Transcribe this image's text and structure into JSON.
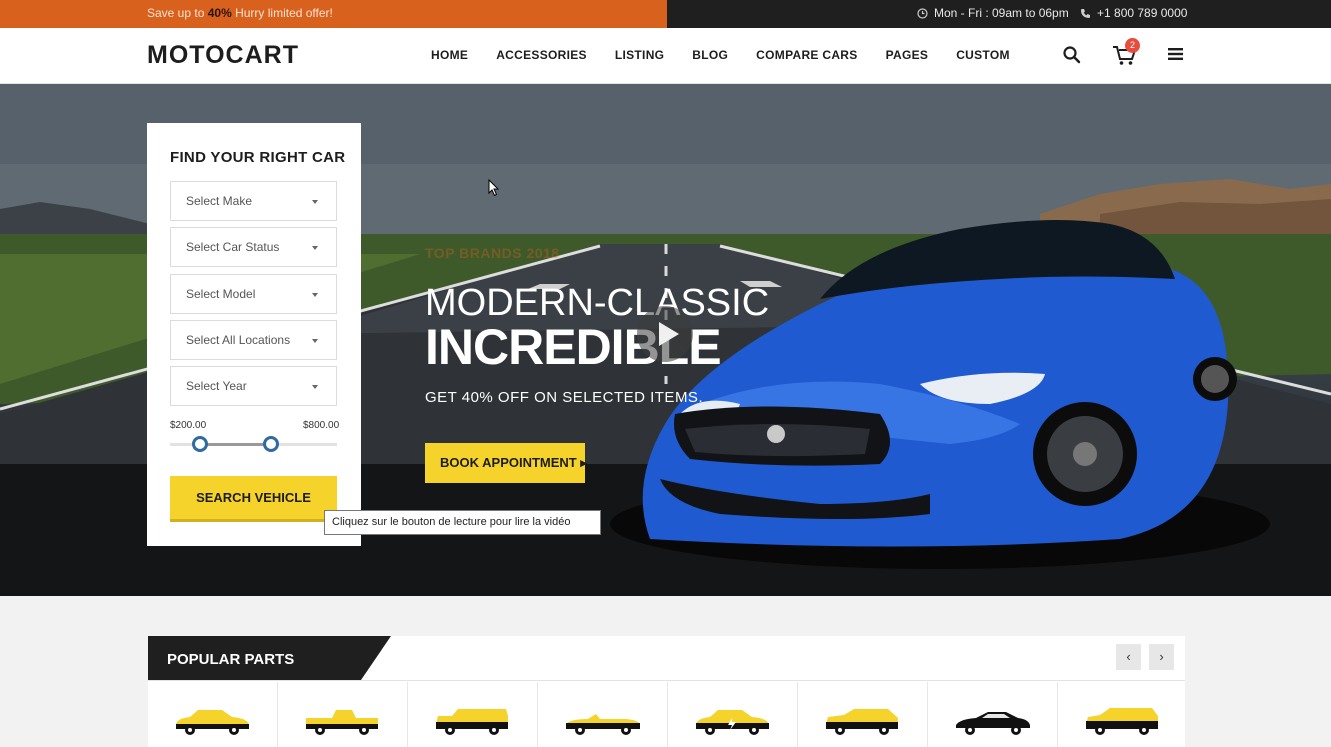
{
  "topbar": {
    "promo_prefix": "Save up to ",
    "promo_highlight": "40%",
    "promo_suffix": " Hurry limited offer!",
    "hours": "Mon - Fri : 09am to 06pm",
    "phone": "+1 800 789 0000",
    "promo_color": "#d9611e"
  },
  "header": {
    "logo": "MOTOCART",
    "nav": [
      "HOME",
      "ACCESSORIES",
      "LISTING",
      "BLOG",
      "COMPARE CARS",
      "PAGES",
      "CUSTOM"
    ],
    "cart_count": "2",
    "icons": [
      "search-icon",
      "cart-icon",
      "hamburger-menu-icon"
    ]
  },
  "finder": {
    "title": "FIND YOUR RIGHT CAR",
    "selects": [
      "Select Make",
      "Select Car Status",
      "Select Model",
      "Select All Locations",
      "Select Year"
    ],
    "price_min": "$200.00",
    "price_max": "$800.00",
    "search_label": "SEARCH VEHICLE",
    "accent_color": "#f5d32a"
  },
  "hero": {
    "eyebrow": "TOP BRANDS 2018",
    "headline_1": "MODERN-CLASSIC",
    "headline_2": "INCREDIBLE",
    "subtitle": "GET 40% OFF ON SELECTED ITEMS.",
    "cta": "BOOK APPOINTMENT ▸",
    "tooltip": "Cliquez sur le bouton de lecture pour lire la vidéo"
  },
  "parts": {
    "title": "POPULAR PARTS",
    "prev": "‹",
    "next": "›",
    "car_types": [
      "sedan-car-icon",
      "pickup-truck-icon",
      "suv-car-icon",
      "convertible-car-icon",
      "electric-car-icon",
      "hatchback-car-icon",
      "sports-coupe-icon",
      "minivan-car-icon"
    ]
  }
}
